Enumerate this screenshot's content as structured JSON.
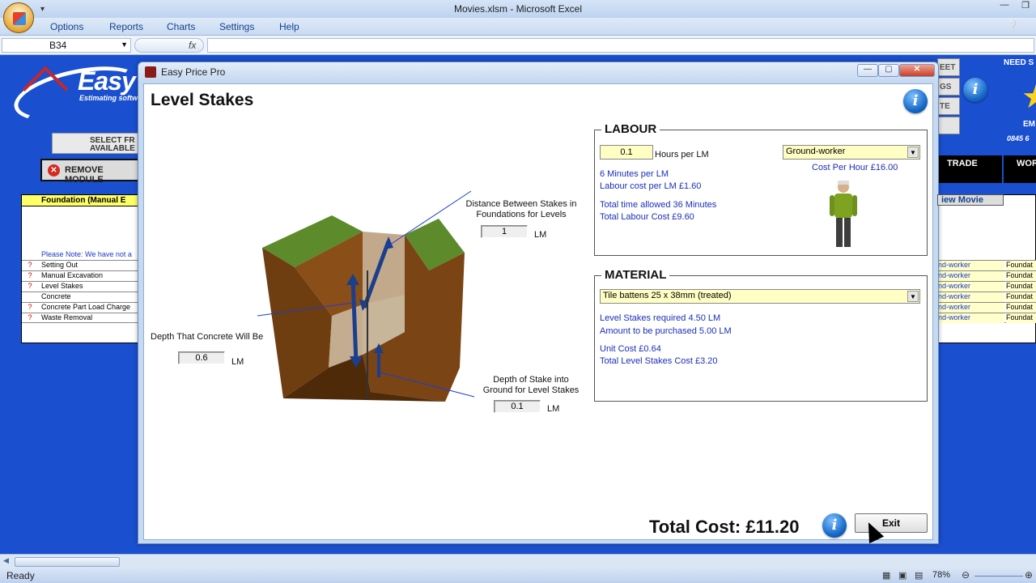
{
  "excel": {
    "window_title": "Movies.xlsm - Microsoft Excel",
    "menu": [
      "Options",
      "Reports",
      "Charts",
      "Settings",
      "Help"
    ],
    "name_box": "B34",
    "fx": "fx",
    "status": "Ready",
    "zoom": "78%"
  },
  "sheet": {
    "logo_text": "Easy",
    "logo_sub": "Estimating softw",
    "select_button": "SELECT FR\nAVAILABLE M",
    "remove_button": "REMOVE MODULE",
    "module_header": "Foundation (Manual E",
    "note": "Please Note: We have not a",
    "rows": [
      {
        "q": "?",
        "name": "Setting Out"
      },
      {
        "q": "?",
        "name": "Manual Excavation"
      },
      {
        "q": "?",
        "name": "Level Stakes"
      },
      {
        "q": "",
        "name": "Concrete"
      },
      {
        "q": "?",
        "name": "Concrete Part Load Charge"
      },
      {
        "q": "?",
        "name": "Waste Removal"
      }
    ],
    "trade_header": "TRADE",
    "work_header": "WOR",
    "view_movie": "iew Movie",
    "right_rows": [
      {
        "a": "nd-worker",
        "b": "Foundat"
      },
      {
        "a": "nd-worker",
        "b": "Foundat"
      },
      {
        "a": "nd-worker",
        "b": "Foundat"
      },
      {
        "a": "nd-worker",
        "b": "Foundat"
      },
      {
        "a": "nd-worker",
        "b": "Foundat"
      },
      {
        "a": "nd-worker",
        "b": "Foundat"
      }
    ],
    "side_buttons": [
      "EET",
      "GS",
      "TE"
    ],
    "need_text": "NEED S",
    "em_text": "EM",
    "phone_text": "0845 6"
  },
  "dialog": {
    "title": "Easy Price Pro",
    "heading": "Level Stakes",
    "diagram": {
      "distance_label": "Distance Between Stakes in\nFoundations for Levels",
      "distance_value": "1",
      "depth_concrete_label": "Depth That Concrete Will Be",
      "depth_concrete_value": "0.6",
      "depth_stake_label": "Depth of Stake into\nGround for Level Stakes",
      "depth_stake_value": "0.1",
      "unit": "LM"
    },
    "labour": {
      "title": "LABOUR",
      "hours_value": "0.1",
      "hours_label": "Hours per LM",
      "worker": "Ground-worker",
      "cost_per_hour": "Cost Per Hour £16.00",
      "minutes": "6 Minutes per LM",
      "labour_cost": "Labour cost per LM  £1.60",
      "total_time": "Total time allowed 36 Minutes",
      "total_labour": "Total Labour Cost £9.60"
    },
    "material": {
      "title": "MATERIAL",
      "item": "Tile battens 25 x 38mm (treated)",
      "required": "Level Stakes required 4.50 LM",
      "purchased": "Amount to be purchased 5.00 LM",
      "unit_cost": "Unit Cost £0.64",
      "total": "Total Level Stakes Cost £3.20"
    },
    "total_cost": "Total Cost: £11.20",
    "exit": "Exit"
  },
  "icons": {
    "info": "i",
    "dropdown": "▼"
  },
  "colors": {
    "sheet_bg": "#1a4fcf",
    "highlight": "#ffffc4",
    "info_text": "#1a2fb8"
  }
}
